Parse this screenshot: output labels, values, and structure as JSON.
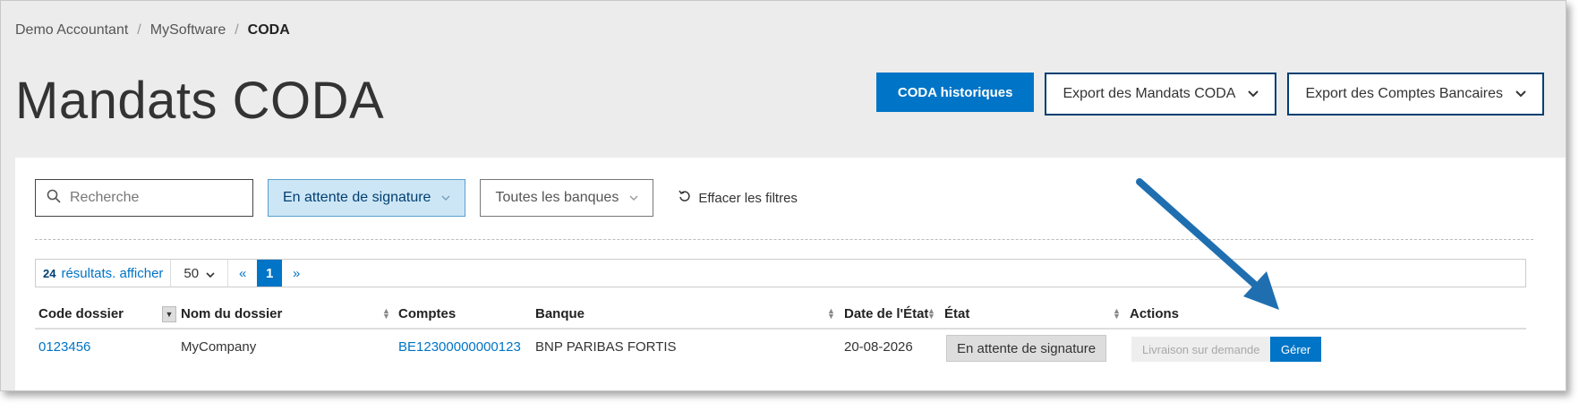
{
  "breadcrumb": {
    "items": [
      "Demo Accountant",
      "MySoftware"
    ],
    "current": "CODA"
  },
  "page": {
    "title": "Mandats CODA"
  },
  "header_actions": {
    "history": "CODA historiques",
    "export_mandates": "Export des Mandats CODA",
    "export_accounts": "Export des Comptes Bancaires"
  },
  "filters": {
    "search_placeholder": "Recherche",
    "status": "En attente de signature",
    "bank": "Toutes les banques",
    "clear": "Effacer les filtres"
  },
  "pager": {
    "count": "24",
    "label": "résultats. afficher",
    "page_size": "50",
    "prev": "«",
    "current_page": "1",
    "next": "»"
  },
  "table": {
    "columns": [
      "Code dossier",
      "Nom du dossier",
      "Comptes",
      "Banque",
      "Date de l'État",
      "État",
      "Actions"
    ],
    "rows": [
      {
        "code": "0123456",
        "name": "MyCompany",
        "account": "BE12300000000123",
        "bank": "BNP PARIBAS FORTIS",
        "date": "20-08-2026",
        "state": "En attente de signature",
        "action_disabled": "Livraison sur demande",
        "action_manage": "Gérer"
      }
    ]
  },
  "colors": {
    "primary": "#0074c6",
    "arrow": "#1f6fb0"
  }
}
